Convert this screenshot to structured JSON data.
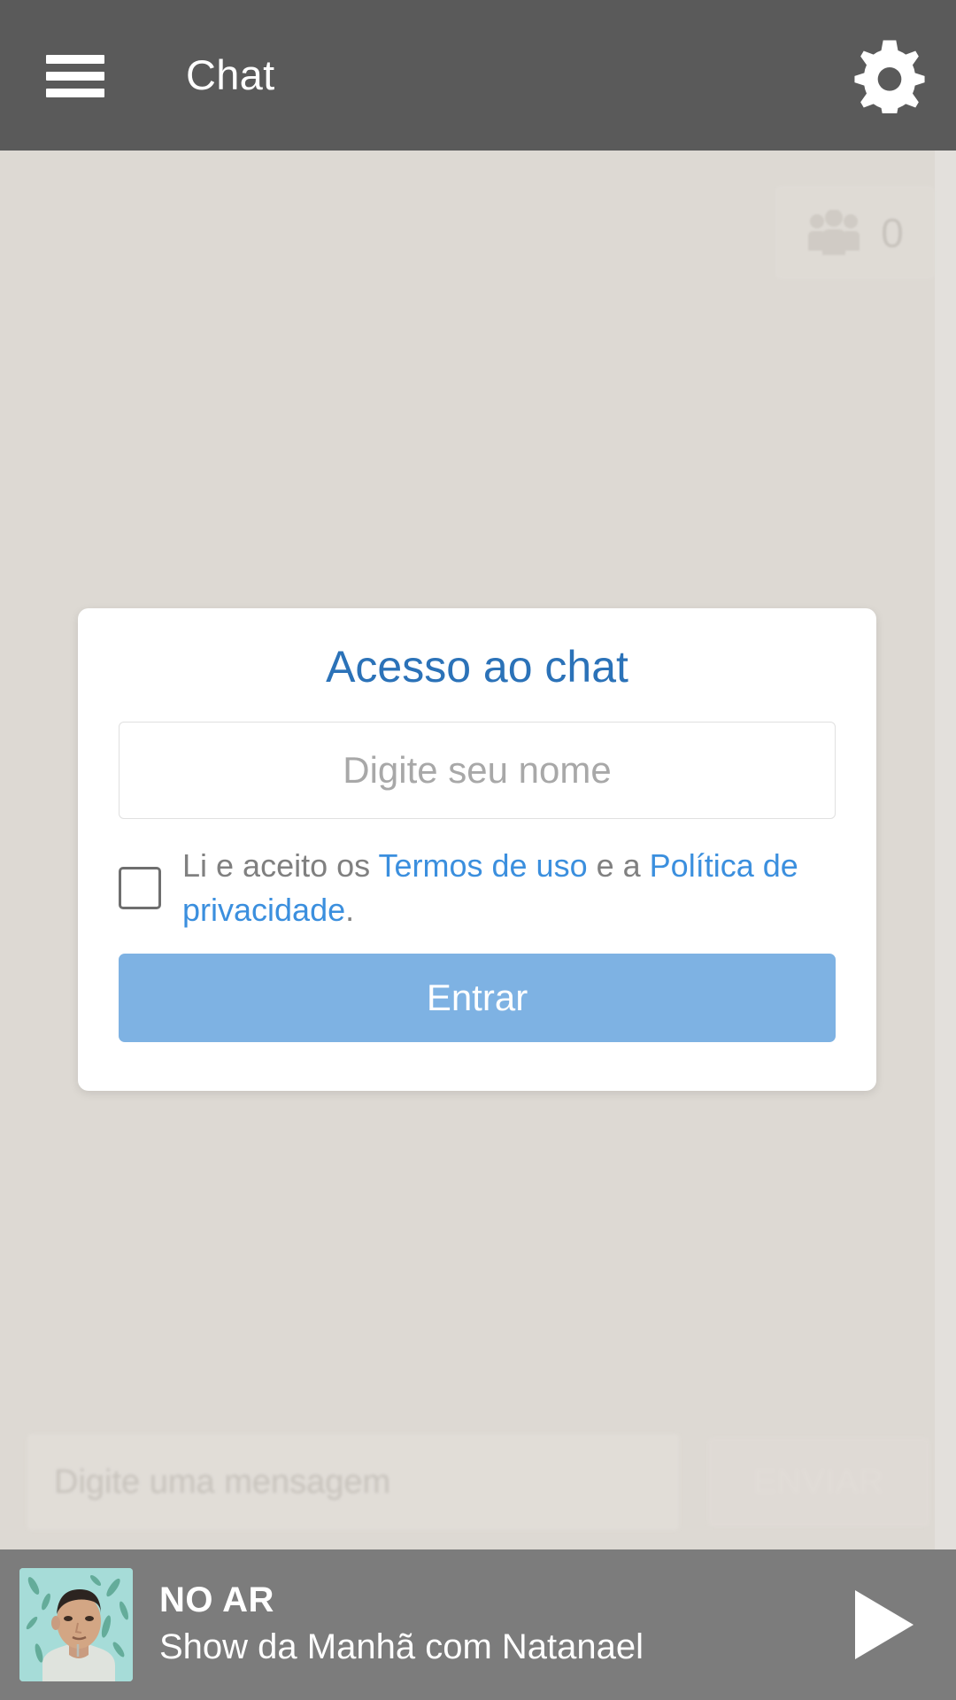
{
  "appbar": {
    "menu_icon": "hamburger-menu-icon",
    "title": "Chat",
    "settings_icon": "gear-icon"
  },
  "content": {
    "users_badge": {
      "icon": "people-group-icon",
      "count": "0"
    },
    "composer": {
      "placeholder": "Digite uma mensagem",
      "send_label": "ENVIAR"
    }
  },
  "modal": {
    "title": "Acesso ao chat",
    "name_placeholder": "Digite seu nome",
    "name_value": "",
    "terms": {
      "prefix": "Li e aceito os ",
      "terms_link": "Termos de uso",
      "middle": " e a ",
      "privacy_link": "Política de privacidade",
      "suffix": "."
    },
    "submit_label": "Entrar",
    "checkbox_checked": false
  },
  "player": {
    "live_label": "NO AR",
    "show_title": "Show da Manhã com Natanael",
    "play_icon": "play-triangle-icon",
    "thumbnail_alt": "host-portrait"
  },
  "colors": {
    "appbar_bg": "#5a5a5a",
    "page_bg": "#ddd9d3",
    "card_bg": "#ffffff",
    "title_blue": "#2b72b8",
    "link_blue": "#3b8fde",
    "button_blue": "#7eb2e3",
    "player_bg": "#7c7c7c",
    "muted_text": "#808080"
  }
}
